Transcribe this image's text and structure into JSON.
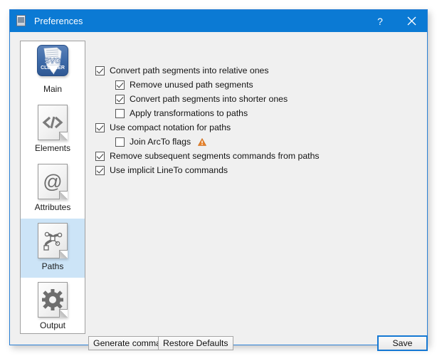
{
  "window": {
    "title": "Preferences",
    "icon": "svg-document-icon",
    "help_label": "?",
    "close_label": "✕",
    "accent_color": "#0b7ad4",
    "border_color": "#2a7fd4",
    "body_color": "#f0f0f0"
  },
  "sidebar": {
    "selected": "Paths",
    "selected_bg": "#cce4f7",
    "items": [
      {
        "label": "Main",
        "icon": "svg-cleaner-logo-icon"
      },
      {
        "label": "Elements",
        "icon": "code-brackets-document-icon"
      },
      {
        "label": "Attributes",
        "icon": "at-sign-document-icon"
      },
      {
        "label": "Paths",
        "icon": "bezier-path-document-icon"
      },
      {
        "label": "Output",
        "icon": "gear-document-icon"
      }
    ]
  },
  "options": [
    {
      "label": "Convert path segments into relative ones",
      "checked": true,
      "indent": false,
      "warning": false
    },
    {
      "label": "Remove unused path segments",
      "checked": true,
      "indent": true,
      "warning": false
    },
    {
      "label": "Convert path segments into shorter ones",
      "checked": true,
      "indent": true,
      "warning": false
    },
    {
      "label": "Apply transformations to paths",
      "checked": false,
      "indent": true,
      "warning": false
    },
    {
      "label": "Use compact notation for paths",
      "checked": true,
      "indent": false,
      "warning": false
    },
    {
      "label": "Join ArcTo flags",
      "checked": false,
      "indent": true,
      "warning": true
    },
    {
      "label": "Remove subsequent segments commands from paths",
      "checked": true,
      "indent": false,
      "warning": false
    },
    {
      "label": "Use implicit LineTo commands",
      "checked": true,
      "indent": false,
      "warning": false
    }
  ],
  "warning_icon_color": "#e8822b",
  "buttons": {
    "generate": "Generate command",
    "restore": "Restore Defaults",
    "save": "Save",
    "save_focus_color": "#1578d3"
  }
}
